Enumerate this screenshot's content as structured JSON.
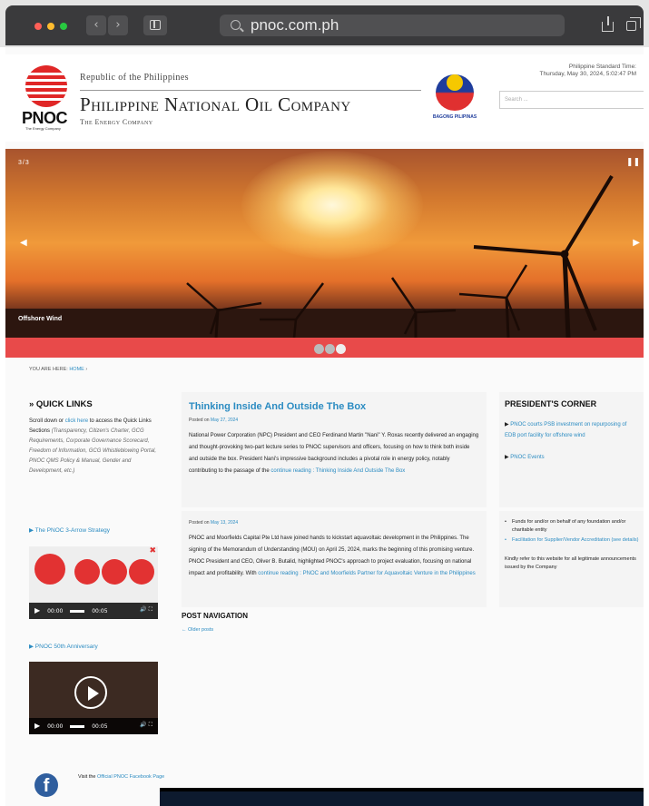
{
  "browser": {
    "url": "pnoc.com.ph",
    "back_glyph": "‹",
    "forward_glyph": "›"
  },
  "header": {
    "logo_text": "PNOC",
    "logo_small": "The Energy Company",
    "republic": "Republic of the Philippines",
    "company_name": "Philippine National Oil Company",
    "tagline": "The Energy Company",
    "bagong_label": "BAGONG PILIPINAS",
    "time_label": "Philippine Standard Time:",
    "time_value": "Thursday, May 30, 2024, 5:02:47 PM",
    "search_placeholder": "Search ..."
  },
  "slider": {
    "caption": "Offshore Wind",
    "counter": "3/3",
    "prev_glyph": "◀",
    "next_glyph": "▶",
    "pause_glyph": "❚❚"
  },
  "breadcrumb": {
    "label": "YOU ARE HERE:",
    "home": "HOME"
  },
  "quick_links": {
    "title": "» QUICK LINKS",
    "text_before": "Scroll down or ",
    "link": "click here",
    "text_after": " to access the Quick Links Sections ",
    "italic": "(Transparency, Citizen's Charter, GCG Requirements, Corporate Governance Scorecard, Freedom of Information, GCG Whistleblowing Portal, PNOC QMS Policy & Manual, Gender and Development, etc.)"
  },
  "videos": [
    {
      "title": "▶ The PNOC 3-Arrow Strategy",
      "time_now": "00:00",
      "time_total": "00:05"
    },
    {
      "title": "▶ PNOC 50th Anniversary",
      "time_now": "00:00",
      "time_total": "00:05"
    }
  ],
  "facebook": {
    "before": "Visit the ",
    "link": "Official PNOC Facebook Page"
  },
  "posts": [
    {
      "title": "Thinking Inside And Outside The Box",
      "posted": "Posted on ",
      "date": "May 27, 2024",
      "body": "National Power Corporation (NPC) President and CEO Ferdinand Martin \"Nani\" Y. Roxas recently delivered an engaging and thought-provoking two-part lecture series to PNOC supervisors and officers, focusing on how to think both inside and outside the box. President Nani's impressive background includes a pivotal role in energy policy, notably contributing to the passage of the",
      "more": "continue reading : Thinking Inside And Outside The Box"
    },
    {
      "posted": "Posted on ",
      "date": "May 13, 2024",
      "body": "PNOC and Moorfields Capital Pte Ltd have joined hands to kickstart aquavoltaic development in the Philippines. The signing of the Memorandum of Understanding (MOU) on April 25, 2024, marks the beginning of this promising venture. PNOC President and CEO, Oliver B. Butalid, highlighted PNOC's approach to project evaluation, focusing on national impact and profitability. With",
      "more": "continue reading : PNOC and Moorfields Partner for Aquavoltaic Venture in the Philippines"
    }
  ],
  "post_navigation": {
    "title": "POST NAVIGATION",
    "older": "← Older posts"
  },
  "presidents_corner": {
    "title": "PRESIDENT'S CORNER",
    "items": [
      "PNOC courts PSB investment on repurposing of EDB port facility for offshore wind",
      "PNOC Events"
    ]
  },
  "notice": {
    "bullet1": "Funds for and/or on behalf of any foundation and/or charitable entity",
    "bullet2": "Facilitation for Supplier/Vendor Accreditation (see details)",
    "kindly": "Kindly refer to this website for all legitimate announcements issued by the Company"
  }
}
